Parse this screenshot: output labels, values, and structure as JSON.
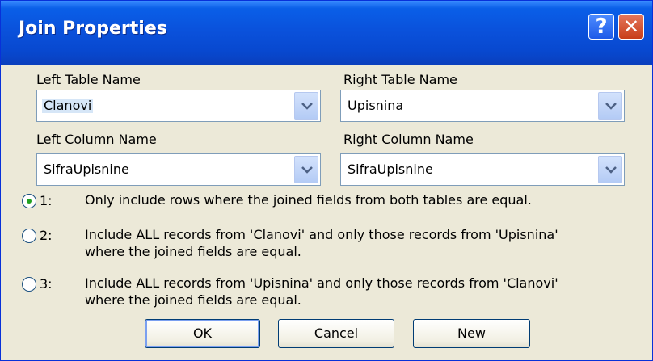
{
  "window": {
    "title": "Join Properties"
  },
  "titlebar_buttons": {
    "help": "?",
    "close": "✕"
  },
  "left_table": {
    "label": "Left Table Name",
    "value": "Clanovi"
  },
  "right_table": {
    "label": "Right Table Name",
    "value": "Upisnina"
  },
  "left_column": {
    "label": "Left Column Name",
    "value": "SifraUpisnine"
  },
  "right_column": {
    "label": "Right Column Name",
    "value": "SifraUpisnine"
  },
  "options": [
    {
      "num": "1:",
      "text_line1": "Only include rows where the joined fields from both tables are equal.",
      "text_line2": "",
      "selected": true
    },
    {
      "num": "2:",
      "text_line1": "Include ALL records from 'Clanovi' and only those records from 'Upisnina'",
      "text_line2": "where the joined fields are equal.",
      "selected": false
    },
    {
      "num": "3:",
      "text_line1": "Include ALL records from 'Upisnina' and only those records from 'Clanovi'",
      "text_line2": "where the joined fields are equal.",
      "selected": false
    }
  ],
  "buttons": {
    "ok": "OK",
    "cancel": "Cancel",
    "new": "New"
  },
  "colors": {
    "title_bar": "#0a52dc",
    "dialog_bg": "#ece9d8",
    "radio_selected": "#21a121",
    "combo_border": "#7f9db9"
  }
}
